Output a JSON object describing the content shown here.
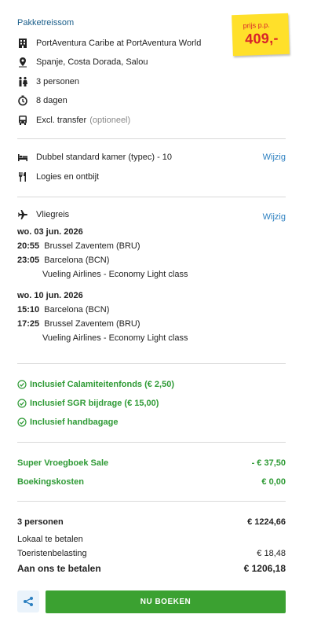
{
  "package": {
    "title": "Pakketreissom",
    "hotel": "PortAventura Caribe at PortAventura World",
    "location": "Spanje, Costa Dorada, Salou",
    "persons": "3 personen",
    "duration": "8 dagen",
    "transfer": "Excl. transfer",
    "transfer_note": "(optioneel)"
  },
  "price_badge": {
    "label": "prijs p.p.",
    "value": "409,-"
  },
  "room": {
    "type": "Dubbel standard kamer (typec) - 10",
    "board": "Logies en ontbijt",
    "change_label": "Wijzig"
  },
  "flight": {
    "label": "Vliegreis",
    "change_label": "Wijzig",
    "legs": [
      {
        "date": "wo. 03 jun. 2026",
        "dep_time": "20:55",
        "dep_place": "Brussel Zaventem (BRU)",
        "arr_time": "23:05",
        "arr_place": "Barcelona (BCN)",
        "carrier": "Vueling Airlines - Economy Light class"
      },
      {
        "date": "wo. 10 jun. 2026",
        "dep_time": "15:10",
        "dep_place": "Barcelona (BCN)",
        "arr_time": "17:25",
        "arr_place": "Brussel Zaventem (BRU)",
        "carrier": "Vueling Airlines - Economy Light class"
      }
    ]
  },
  "inclusions": [
    "Inclusief Calamiteitenfonds (€ 2,50)",
    "Inclusief SGR bijdrage (€ 15,00)",
    "Inclusief handbagage"
  ],
  "discounts": [
    {
      "label": "Super Vroegboek Sale",
      "value": "- € 37,50"
    },
    {
      "label": "Boekingskosten",
      "value": "€ 0,00"
    }
  ],
  "summary": {
    "persons_label": "3 personen",
    "persons_total": "€ 1224,66",
    "local_label": "Lokaal te betalen",
    "tax_label": "Toeristenbelasting",
    "tax_value": "€ 18,48",
    "pay_label": "Aan ons te betalen",
    "pay_value": "€ 1206,18"
  },
  "actions": {
    "book_label": "NU BOEKEN"
  },
  "colors": {
    "accent_blue": "#2b7fc0",
    "green": "#3ba131",
    "badge_yellow": "#ffe02a",
    "badge_red": "#d8232a"
  }
}
